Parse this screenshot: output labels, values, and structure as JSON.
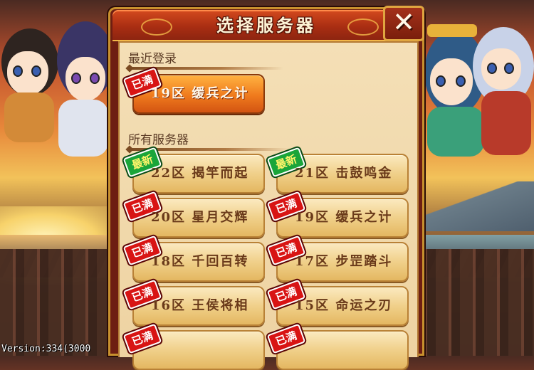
{
  "dialog": {
    "title": "选择服务器",
    "close_icon": "close-x-icon"
  },
  "recent": {
    "label": "最近登录",
    "server": {
      "name": "19区 缓兵之计",
      "badge": "已满"
    }
  },
  "all": {
    "label": "所有服务器",
    "servers": [
      {
        "name": "22区 揭竿而起",
        "badge": "最新",
        "status": "new"
      },
      {
        "name": "21区 击鼓鸣金",
        "badge": "最新",
        "status": "new"
      },
      {
        "name": "20区 星月交辉",
        "badge": "已满",
        "status": "full"
      },
      {
        "name": "19区 缓兵之计",
        "badge": "已满",
        "status": "full"
      },
      {
        "name": "18区 千回百转",
        "badge": "已满",
        "status": "full"
      },
      {
        "name": "17区 步罡踏斗",
        "badge": "已满",
        "status": "full"
      },
      {
        "name": "16区 王侯将相",
        "badge": "已满",
        "status": "full"
      },
      {
        "name": "15区 命运之刃",
        "badge": "已满",
        "status": "full"
      },
      {
        "name": "",
        "badge": "已满",
        "status": "full"
      },
      {
        "name": "",
        "badge": "已满",
        "status": "full"
      }
    ]
  },
  "footer": {
    "version": "Version:334(3000"
  },
  "colors": {
    "badge_full": "#d81414",
    "badge_new": "#1aa53a",
    "panel_header": "#a82d12",
    "panel_body": "#f4dfb6"
  }
}
